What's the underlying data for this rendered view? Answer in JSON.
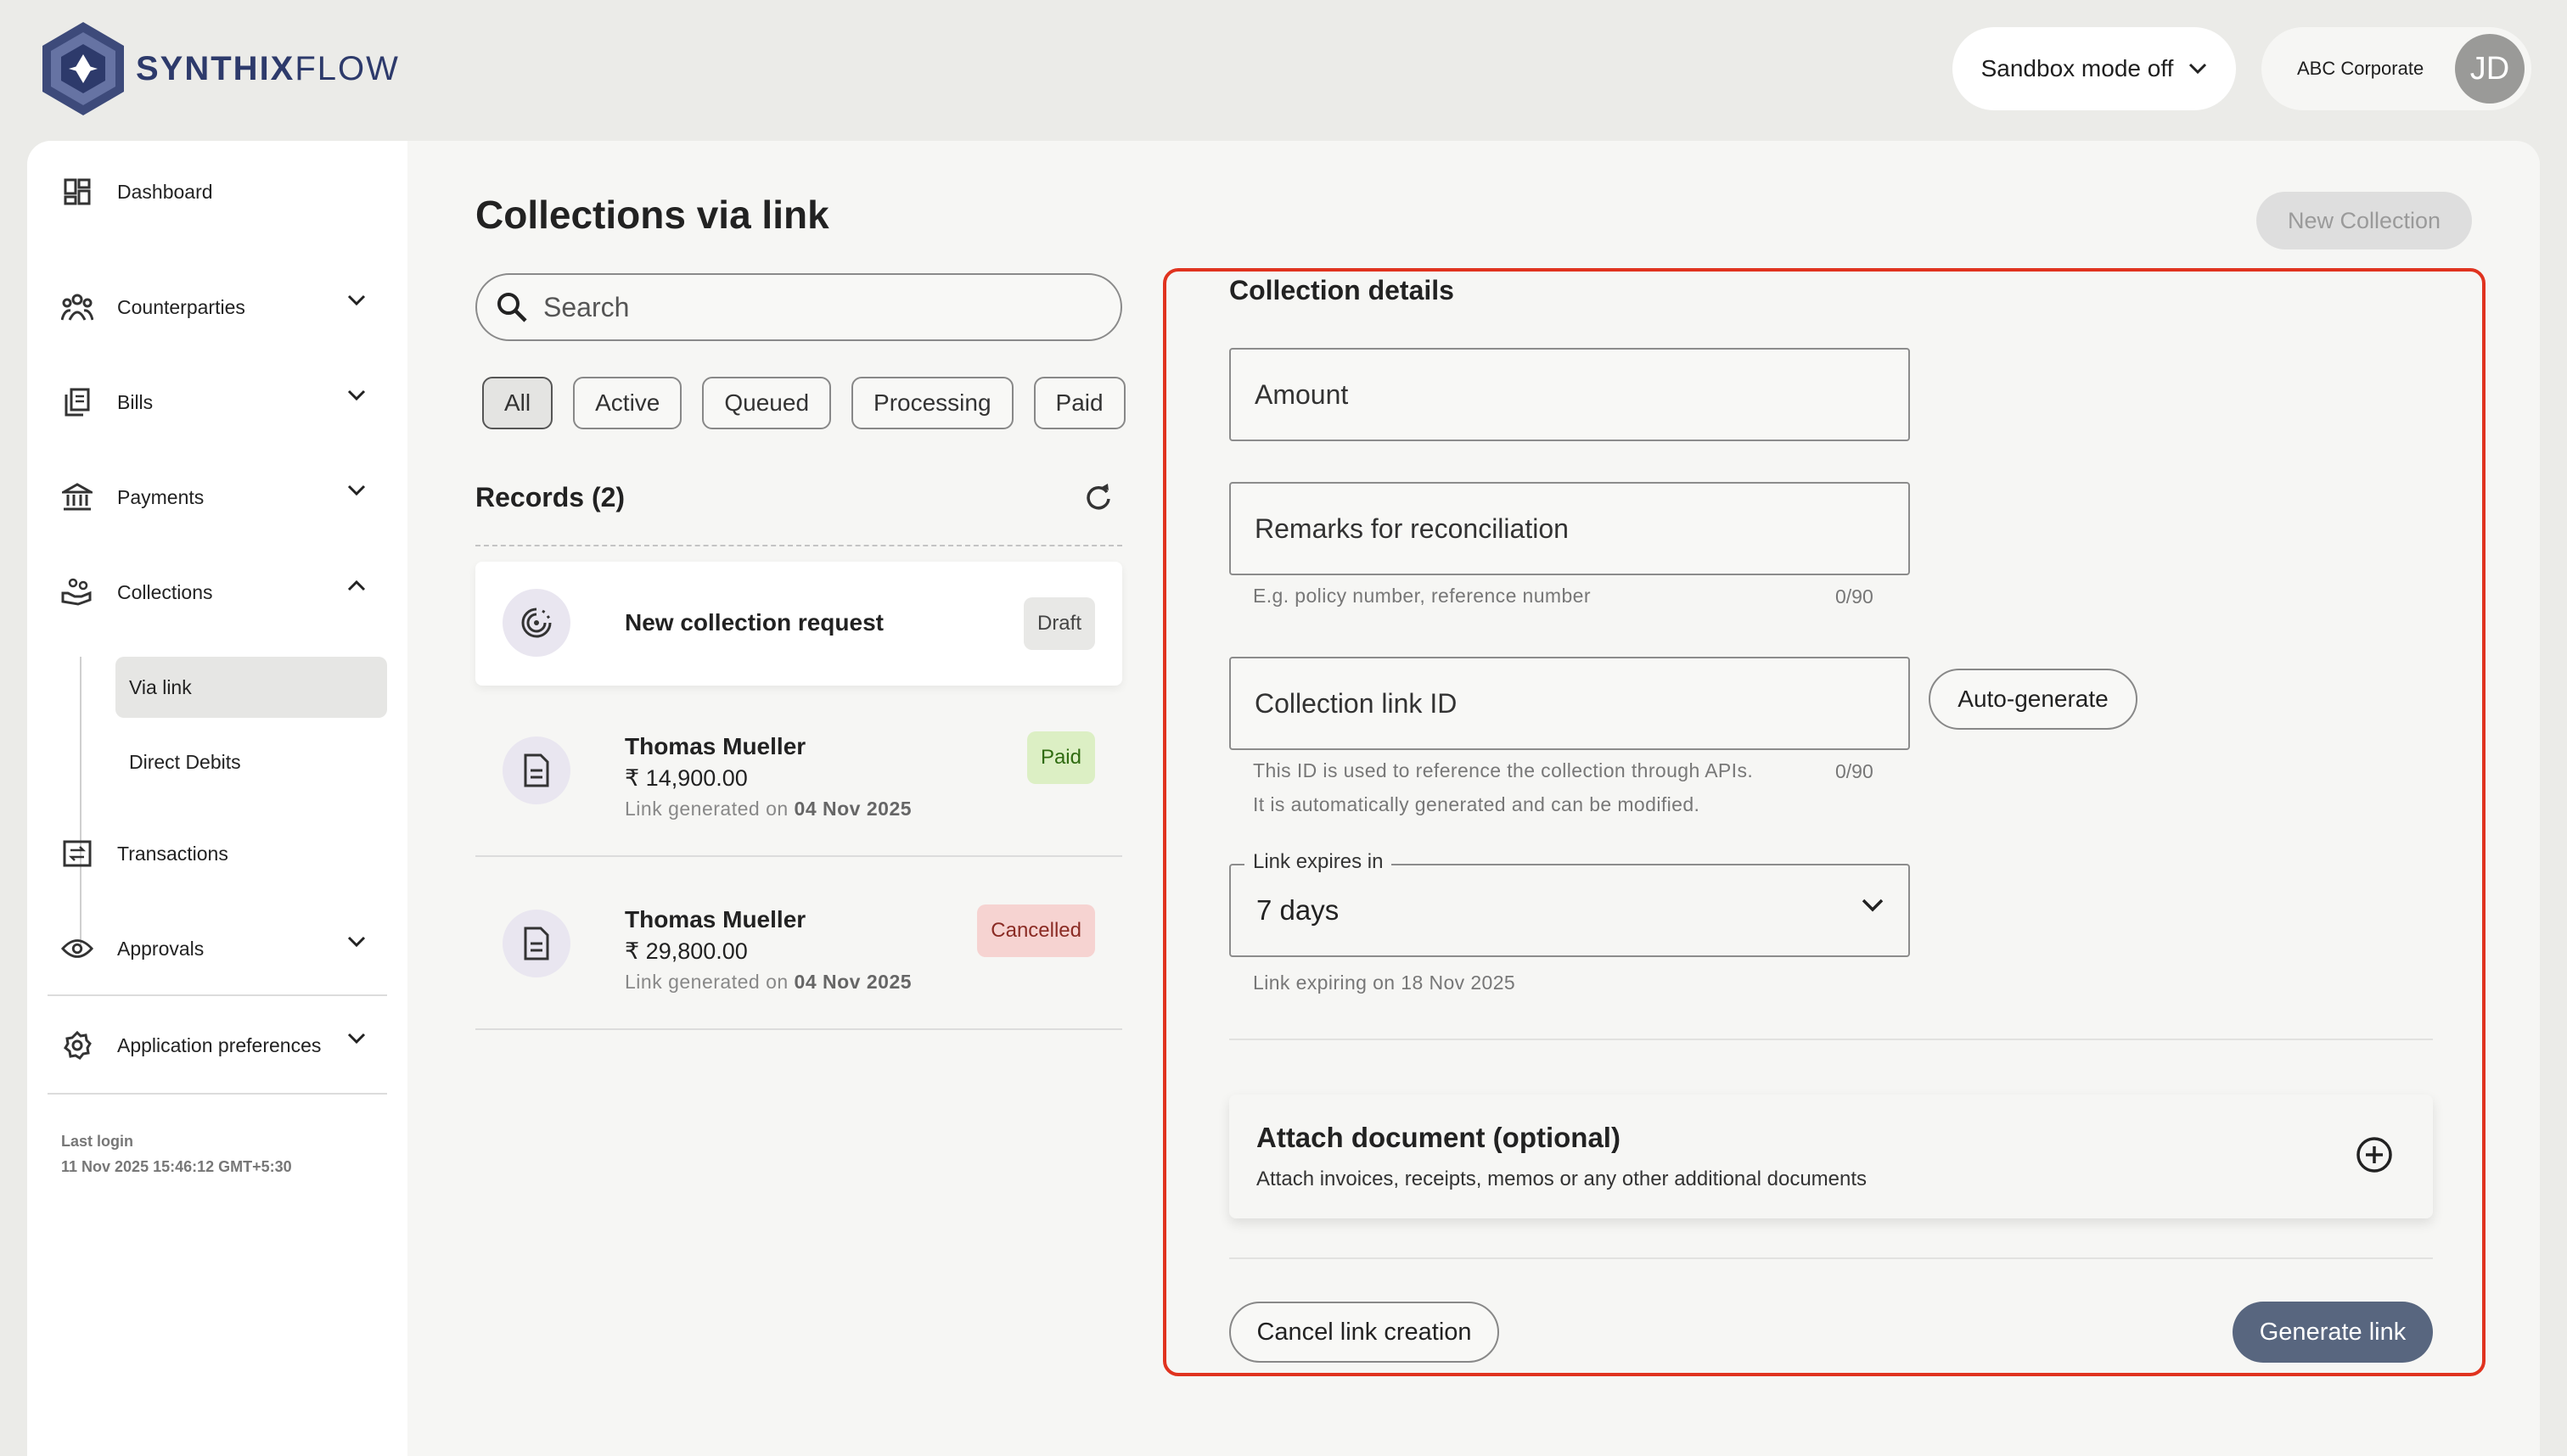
{
  "brand": {
    "name_bold": "SYNTHIX",
    "name_light": "FLOW"
  },
  "topbar": {
    "sandbox_label": "Sandbox mode off",
    "account_name": "ABC Corporate",
    "avatar_initials": "JD"
  },
  "sidebar": {
    "items": [
      {
        "label": "Dashboard",
        "icon": "dashboard-icon"
      },
      {
        "label": "Counterparties",
        "icon": "people-icon"
      },
      {
        "label": "Bills",
        "icon": "bills-icon"
      },
      {
        "label": "Payments",
        "icon": "bank-icon"
      },
      {
        "label": "Collections",
        "icon": "collections-icon"
      },
      {
        "label": "Transactions",
        "icon": "transactions-icon"
      },
      {
        "label": "Approvals",
        "icon": "eye-icon"
      },
      {
        "label": "Application preferences",
        "icon": "gear-icon"
      }
    ],
    "collections_sub": [
      "Via link",
      "Direct Debits"
    ],
    "last_login_label": "Last login",
    "last_login_value": "11 Nov 2025 15:46:12 GMT+5:30"
  },
  "main": {
    "title": "Collections via link",
    "new_collection_label": "New Collection",
    "search_placeholder": "Search",
    "filters": [
      "All",
      "Active",
      "Queued",
      "Processing",
      "Paid"
    ],
    "records_title": "Records (2)",
    "records": [
      {
        "name": "New collection request",
        "status": "Draft"
      },
      {
        "name": "Thomas Mueller",
        "amount": "₹ 14,900.00",
        "date_prefix": "Link generated on",
        "date": "04 Nov 2025",
        "status": "Paid"
      },
      {
        "name": "Thomas Mueller",
        "amount": "₹ 29,800.00",
        "date_prefix": "Link generated on",
        "date": "04 Nov 2025",
        "status": "Cancelled"
      }
    ]
  },
  "form": {
    "section_title": "Collection details",
    "amount_label": "Amount",
    "remarks_label": "Remarks for reconciliation",
    "remarks_hint": "E.g. policy number, reference number",
    "remarks_counter": "0/90",
    "link_id_label": "Collection link ID",
    "link_id_hint_1": "This ID is used to reference the collection through APIs.",
    "link_id_hint_2": "It is automatically generated and can be modified.",
    "link_id_counter": "0/90",
    "autogen_label": "Auto-generate",
    "expires_label": "Link expires in",
    "expires_value": "7 days",
    "expires_hint": "Link expiring on 18 Nov 2025",
    "attach_title": "Attach document (optional)",
    "attach_sub": "Attach invoices, receipts, memos or any other additional documents",
    "cancel_label": "Cancel link creation",
    "generate_label": "Generate link"
  },
  "colors": {
    "accent": "#58667f",
    "highlight_border": "#e0331f",
    "paid_bg": "#dcefc4",
    "cancelled_bg": "#f6d3d1",
    "draft_bg": "#e8e8e6"
  }
}
